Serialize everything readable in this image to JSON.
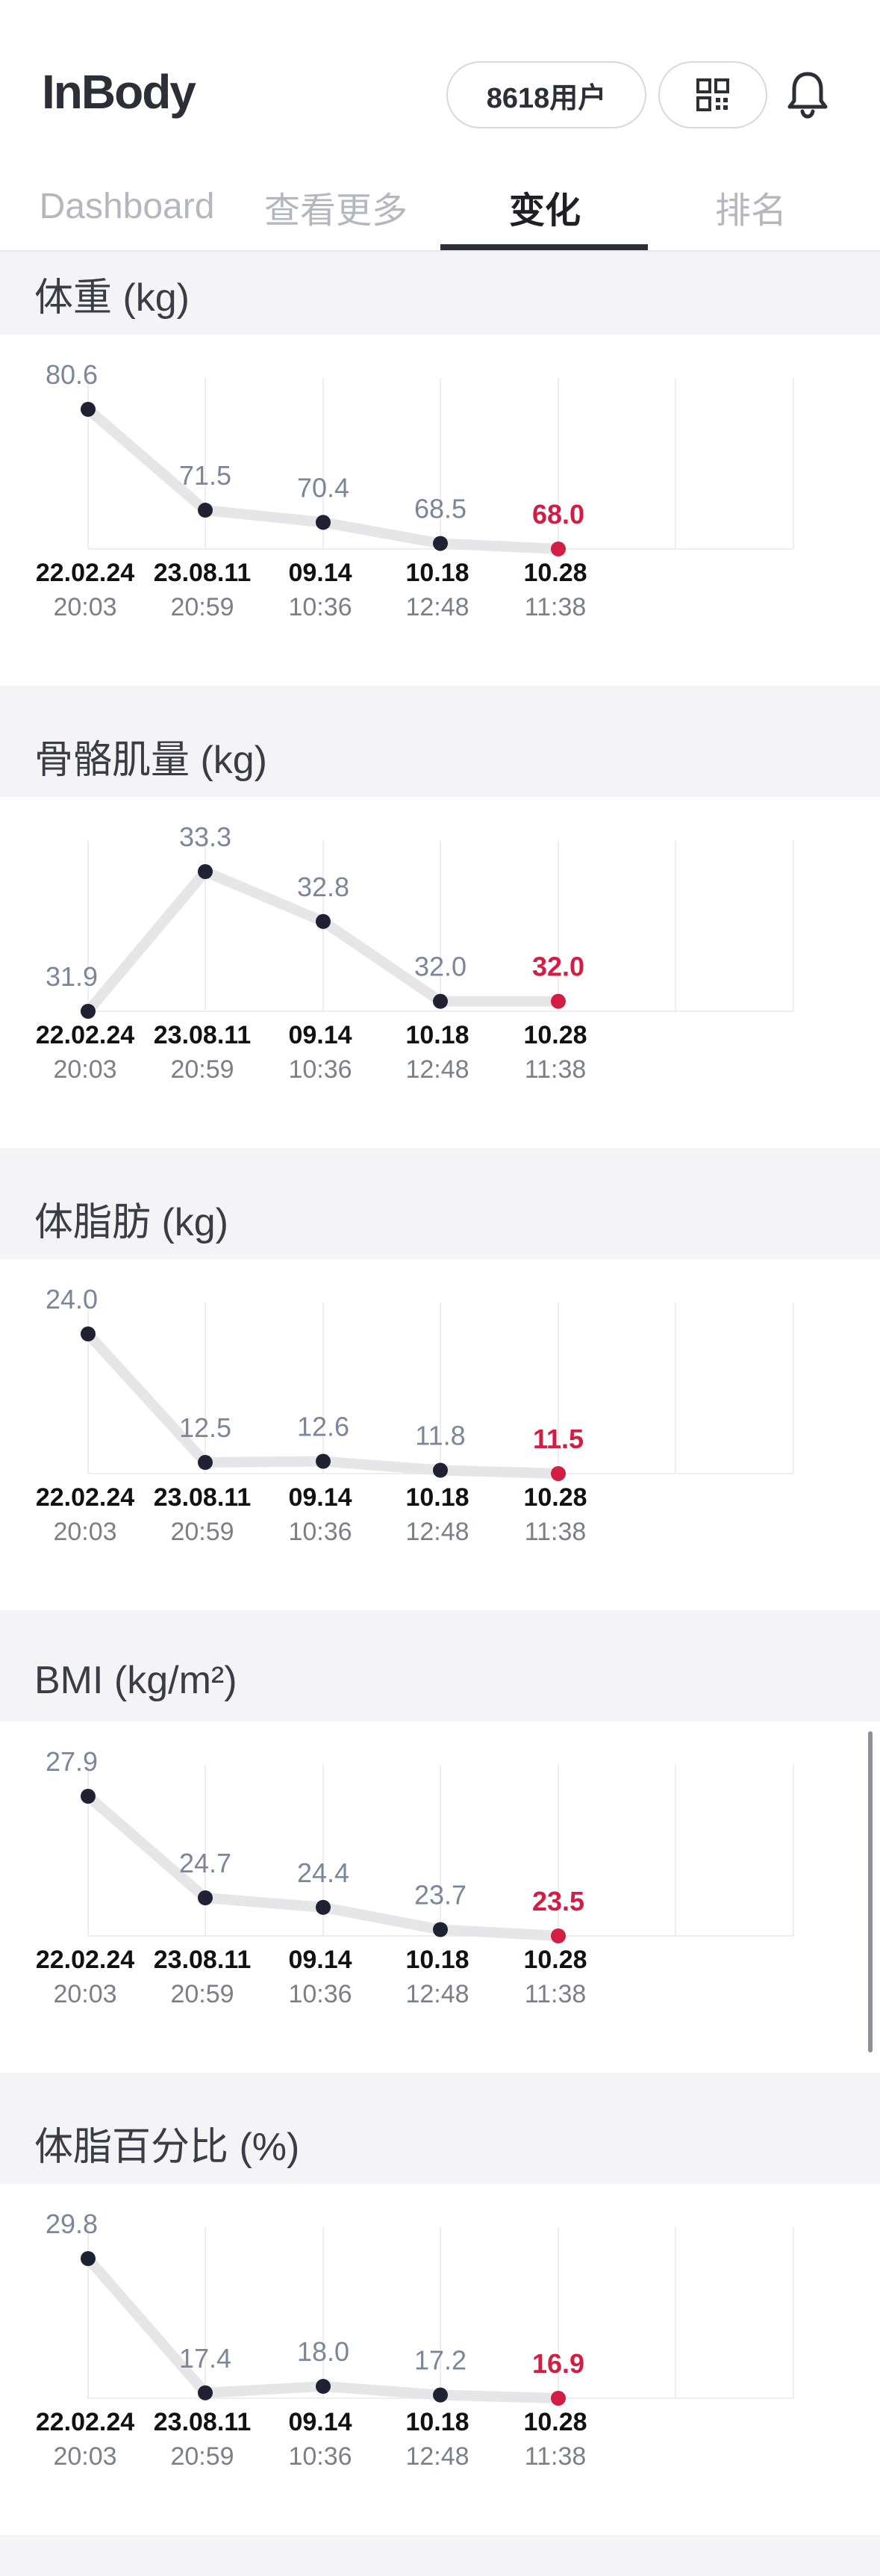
{
  "header": {
    "logo": "InBody",
    "users_label": "8618用户",
    "qr_icon": "qr-code-icon",
    "bell_icon": "bell-icon"
  },
  "tabs": [
    {
      "label": "Dashboard",
      "active": false
    },
    {
      "label": "查看更多",
      "active": false
    },
    {
      "label": "变化",
      "active": true
    },
    {
      "label": "排名",
      "active": false
    }
  ],
  "colors": {
    "point": "#1e2233",
    "latest": "#d21d45",
    "line": "#e6e6e8",
    "value_text": "#7c8699",
    "grid": "#eeeeef"
  },
  "chart_data": [
    {
      "type": "line",
      "title": "体重 (kg)",
      "x": [
        "22.02.24 20:03",
        "23.08.11 20:59",
        "09.14 10:36",
        "10.18 12:48",
        "10.28 11:38"
      ],
      "x_date": [
        "22.02.24",
        "23.08.11",
        "09.14",
        "10.18",
        "10.28"
      ],
      "x_time": [
        "20:03",
        "20:59",
        "10:36",
        "12:48",
        "11:38"
      ],
      "values": [
        80.6,
        71.5,
        70.4,
        68.5,
        68.0
      ],
      "labels": [
        "80.6",
        "71.5",
        "70.4",
        "68.5",
        "68.0"
      ],
      "ylim": [
        68.0,
        80.6
      ]
    },
    {
      "type": "line",
      "title": "骨骼肌量 (kg)",
      "x": [
        "22.02.24 20:03",
        "23.08.11 20:59",
        "09.14 10:36",
        "10.18 12:48",
        "10.28 11:38"
      ],
      "x_date": [
        "22.02.24",
        "23.08.11",
        "09.14",
        "10.18",
        "10.28"
      ],
      "x_time": [
        "20:03",
        "20:59",
        "10:36",
        "12:48",
        "11:38"
      ],
      "values": [
        31.9,
        33.3,
        32.8,
        32.0,
        32.0
      ],
      "labels": [
        "31.9",
        "33.3",
        "32.8",
        "32.0",
        "32.0"
      ],
      "ylim": [
        31.9,
        33.3
      ]
    },
    {
      "type": "line",
      "title": "体脂肪 (kg)",
      "x": [
        "22.02.24 20:03",
        "23.08.11 20:59",
        "09.14 10:36",
        "10.18 12:48",
        "10.28 11:38"
      ],
      "x_date": [
        "22.02.24",
        "23.08.11",
        "09.14",
        "10.18",
        "10.28"
      ],
      "x_time": [
        "20:03",
        "20:59",
        "10:36",
        "12:48",
        "11:38"
      ],
      "values": [
        24.0,
        12.5,
        12.6,
        11.8,
        11.5
      ],
      "labels": [
        "24.0",
        "12.5",
        "12.6",
        "11.8",
        "11.5"
      ],
      "ylim": [
        11.5,
        24.0
      ]
    },
    {
      "type": "line",
      "title": "BMI (kg/m²)",
      "x": [
        "22.02.24 20:03",
        "23.08.11 20:59",
        "09.14 10:36",
        "10.18 12:48",
        "10.28 11:38"
      ],
      "x_date": [
        "22.02.24",
        "23.08.11",
        "09.14",
        "10.18",
        "10.28"
      ],
      "x_time": [
        "20:03",
        "20:59",
        "10:36",
        "12:48",
        "11:38"
      ],
      "values": [
        27.9,
        24.7,
        24.4,
        23.7,
        23.5
      ],
      "labels": [
        "27.9",
        "24.7",
        "24.4",
        "23.7",
        "23.5"
      ],
      "ylim": [
        23.5,
        27.9
      ]
    },
    {
      "type": "line",
      "title": "体脂百分比 (%)",
      "x": [
        "22.02.24 20:03",
        "23.08.11 20:59",
        "09.14 10:36",
        "10.18 12:48",
        "10.28 11:38"
      ],
      "x_date": [
        "22.02.24",
        "23.08.11",
        "09.14",
        "10.18",
        "10.28"
      ],
      "x_time": [
        "20:03",
        "20:59",
        "10:36",
        "12:48",
        "11:38"
      ],
      "values": [
        29.8,
        17.4,
        18.0,
        17.2,
        16.9
      ],
      "labels": [
        "29.8",
        "17.4",
        "18.0",
        "17.2",
        "16.9"
      ],
      "ylim": [
        16.9,
        29.8
      ]
    }
  ]
}
